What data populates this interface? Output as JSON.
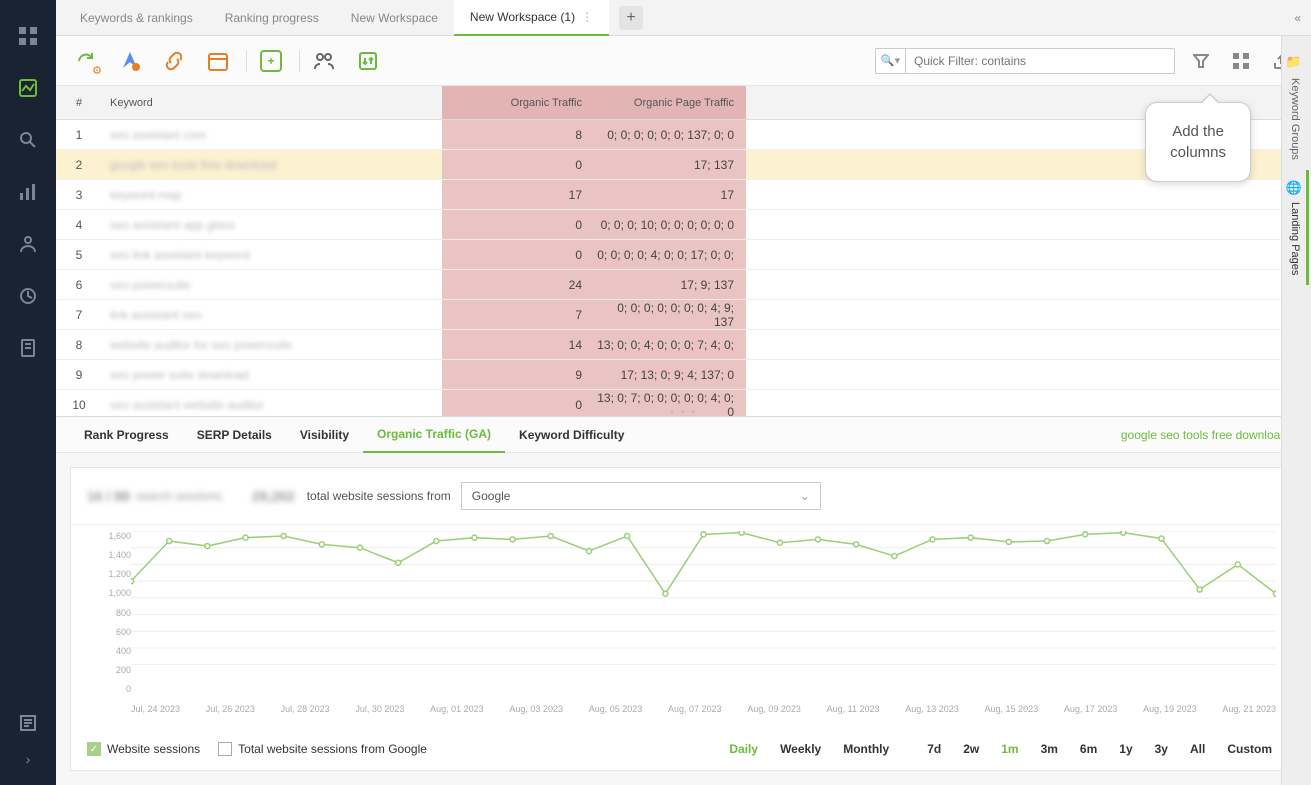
{
  "left_nav": {
    "items": [
      "dashboard",
      "analytics",
      "search",
      "bars",
      "user",
      "clock",
      "doc"
    ],
    "active_index": 1
  },
  "tabs": {
    "items": [
      "Keywords & rankings",
      "Ranking progress",
      "New Workspace",
      "New Workspace (1)"
    ],
    "active_index": 3
  },
  "toolbar": {
    "search_placeholder": "Quick Filter: contains"
  },
  "callout": {
    "line1": "Add the",
    "line2": "columns"
  },
  "right_rail": {
    "items": [
      "Keyword Groups",
      "Landing Pages"
    ],
    "active_index": 1
  },
  "table": {
    "headers": {
      "idx": "#",
      "keyword": "Keyword",
      "organic_traffic": "Organic Traffic",
      "organic_page_traffic": "Organic Page Traffic"
    },
    "rows": [
      {
        "idx": 1,
        "kw": "seo assistant com",
        "ot": "8",
        "opt": "0; 0; 0; 0; 0; 0; 137; 0; 0"
      },
      {
        "idx": 2,
        "kw": "google seo tools free download",
        "ot": "0",
        "opt": "17; 137"
      },
      {
        "idx": 3,
        "kw": "keyword map",
        "ot": "17",
        "opt": "17"
      },
      {
        "idx": 4,
        "kw": "seo assistant app glass",
        "ot": "0",
        "opt": "0; 0; 0; 10; 0; 0; 0; 0; 0; 0"
      },
      {
        "idx": 5,
        "kw": "seo link assistant keyword",
        "ot": "0",
        "opt": "0; 0; 0; 0; 4; 0; 0; 17; 0; 0;"
      },
      {
        "idx": 6,
        "kw": "seo powersuite",
        "ot": "24",
        "opt": "17; 9; 137"
      },
      {
        "idx": 7,
        "kw": "link assistant seo",
        "ot": "7",
        "opt": "0; 0; 0; 0; 0; 0; 0; 4; 9; 137"
      },
      {
        "idx": 8,
        "kw": "website auditor for seo powersuite",
        "ot": "14",
        "opt": "13; 0; 0; 4; 0; 0; 0; 7; 4; 0;"
      },
      {
        "idx": 9,
        "kw": "seo power suite download",
        "ot": "9",
        "opt": "17; 13; 0; 9; 4; 137; 0"
      },
      {
        "idx": 10,
        "kw": "seo assistant website auditor",
        "ot": "0",
        "opt": "13; 0; 7; 0; 0; 0; 0; 0; 4; 0; 0"
      }
    ],
    "selected_index": 1
  },
  "lower_tabs": {
    "items": [
      "Rank Progress",
      "SERP Details",
      "Visibility",
      "Organic Traffic (GA)",
      "Keyword Difficulty"
    ],
    "active_index": 3,
    "selected_keyword": "google seo tools free download"
  },
  "lower_top": {
    "blur1": "16 / 88",
    "blur1_label": "search sessions",
    "blur2": "29,262",
    "sessions_label": "total website sessions from",
    "source": "Google"
  },
  "chart_data": {
    "type": "line",
    "title": "",
    "xlabel": "",
    "ylabel": "",
    "ylim": [
      0,
      1600
    ],
    "y_ticks": [
      1600,
      1400,
      1200,
      1000,
      800,
      600,
      400,
      200,
      0
    ],
    "x_labels": [
      "Jul, 24 2023",
      "Jul, 26 2023",
      "Jul, 28 2023",
      "Jul, 30 2023",
      "Aug, 01 2023",
      "Aug, 03 2023",
      "Aug, 05 2023",
      "Aug, 07 2023",
      "Aug, 09 2023",
      "Aug, 11 2023",
      "Aug, 13 2023",
      "Aug, 15 2023",
      "Aug, 17 2023",
      "Aug, 19 2023",
      "Aug, 21 2023"
    ],
    "series": [
      {
        "name": "Website sessions",
        "color": "#9bcf78",
        "values": [
          1000,
          1480,
          1420,
          1520,
          1540,
          1440,
          1400,
          1220,
          1480,
          1520,
          1500,
          1540,
          1360,
          1540,
          850,
          1560,
          1580,
          1460,
          1500,
          1440,
          1300,
          1500,
          1520,
          1470,
          1480,
          1560,
          1580,
          1510,
          900,
          1200,
          850
        ]
      }
    ]
  },
  "legend": {
    "checked": "Website sessions",
    "unchecked": "Total website sessions from Google"
  },
  "ranges": {
    "freq": [
      "Daily",
      "Weekly",
      "Monthly"
    ],
    "freq_active": 0,
    "span": [
      "7d",
      "2w",
      "1m",
      "3m",
      "6m",
      "1y",
      "3y",
      "All",
      "Custom"
    ],
    "span_active": 2
  }
}
